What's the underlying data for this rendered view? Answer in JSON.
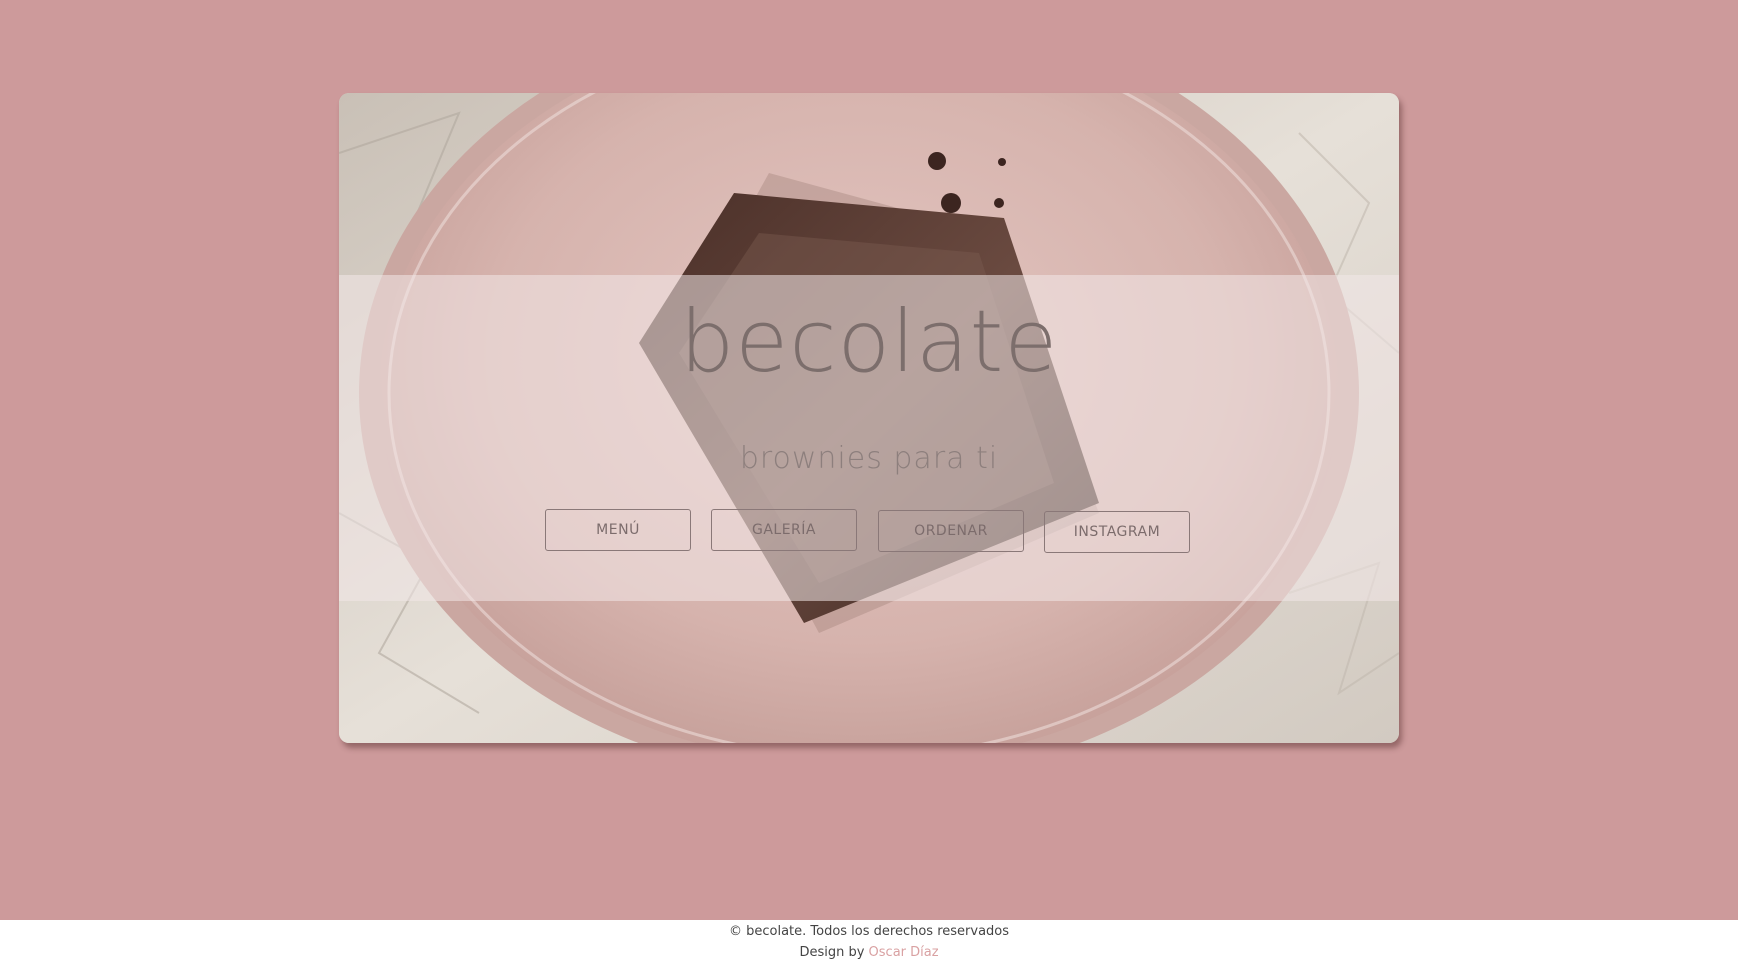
{
  "colors": {
    "page_background": "#cd9a9b",
    "footer_background": "#ffffff",
    "footer_link": "#d9a1a2",
    "button_border": "#8a7878"
  },
  "hero": {
    "title": "becolate",
    "tagline": "brownies para ti",
    "image_icon": "brownie-on-plate-photo"
  },
  "nav": {
    "buttons": [
      "MENÚ",
      "GALERÍA",
      "ORDENAR",
      "INSTAGRAM"
    ]
  },
  "footer": {
    "copyright": "© becolate. Todos los derechos reservados",
    "design_prefix": "Design by ",
    "designer_name": "Oscar Díaz"
  }
}
